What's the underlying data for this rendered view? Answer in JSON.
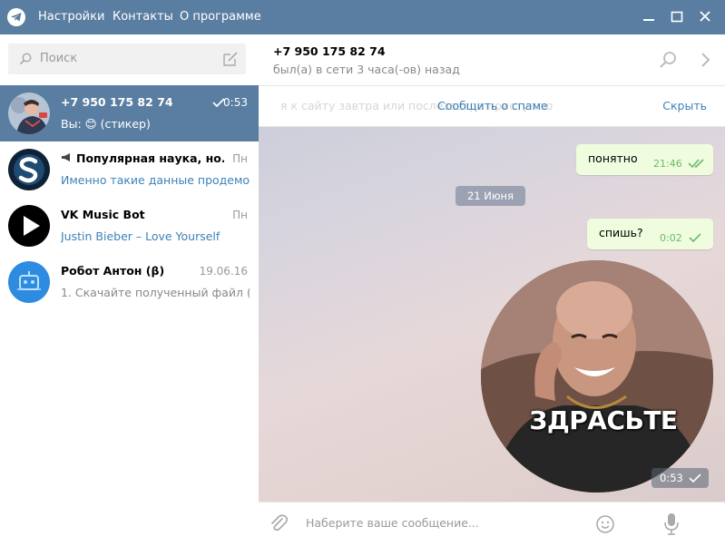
{
  "titlebar": {
    "menu": [
      "Настройки",
      "Контакты",
      "О программе"
    ],
    "colors": {
      "bar": "#5a7ea1"
    }
  },
  "search": {
    "placeholder": "Поиск"
  },
  "chats": [
    {
      "name": "+7 950 175 82 74",
      "time": "0:53",
      "preview_prefix": "Вы: ",
      "preview_emoji": "😊",
      "preview_text": " (стикер)",
      "sent_check": true,
      "active": true
    },
    {
      "name": "Популярная наука, но...",
      "time": "Пн",
      "preview": "Именно такие данные продемо...",
      "channel": true
    },
    {
      "name": "VK Music Bot",
      "time": "Пн",
      "preview": "Justin Bieber – Love Yourself"
    },
    {
      "name": "Робот Антон (β)",
      "time": "19.06.16",
      "preview": "1. Скачайте полученный файл (..."
    }
  ],
  "header": {
    "title": "+7 950 175 82 74",
    "status": "был(а) в сети 3 часа(-ов) назад"
  },
  "spam_bar": {
    "background_text": "я к сайту завтра или послезавтра приступлю",
    "report": "Сообщить о спаме",
    "hide": "Скрыть"
  },
  "messages": [
    {
      "text": "понятно",
      "time": "21:46",
      "status": "read"
    },
    {
      "date": "21 Июня"
    },
    {
      "text": "спишь?",
      "time": "0:02",
      "status": "sent"
    },
    {
      "sticker_caption": "ЗДРАСЬТЕ",
      "time": "0:53",
      "status": "sent"
    }
  ],
  "composer": {
    "placeholder": "Наберите ваше сообщение..."
  },
  "colors": {
    "accent": "#3d82b8",
    "bubble": "#effdde",
    "check": "#6cb96e"
  }
}
